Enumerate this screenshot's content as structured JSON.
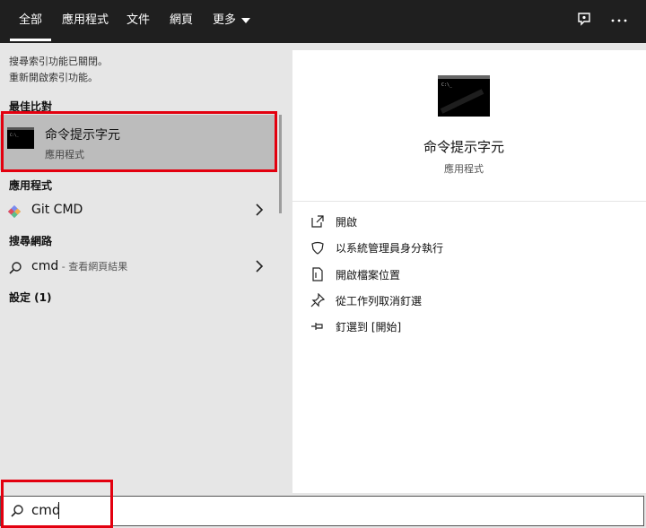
{
  "topbar": {
    "tabs": [
      {
        "label": "全部",
        "active": true
      },
      {
        "label": "應用程式"
      },
      {
        "label": "文件"
      },
      {
        "label": "網頁"
      },
      {
        "label": "更多"
      }
    ],
    "feedback_icon": "feedback-icon",
    "more_icon": "ellipsis-icon"
  },
  "left": {
    "notice_line1": "搜尋索引功能已關閉。",
    "notice_line2": "重新開啟索引功能。",
    "best_match_header": "最佳比對",
    "best_match": {
      "title": "命令提示字元",
      "subtitle": "應用程式",
      "icon": "terminal-icon"
    },
    "apps_header": "應用程式",
    "apps": [
      {
        "label": "Git CMD",
        "icon": "git-icon"
      }
    ],
    "web_header": "搜尋網路",
    "web_result": {
      "query": "cmd",
      "suffix": " - 查看網頁結果",
      "icon": "search-icon"
    },
    "settings_header": "設定 (1)"
  },
  "right": {
    "title": "命令提示字元",
    "subtitle": "應用程式",
    "actions": [
      {
        "label": "開啟",
        "icon": "open-icon"
      },
      {
        "label": "以系統管理員身分執行",
        "icon": "shield-icon"
      },
      {
        "label": "開啟檔案位置",
        "icon": "file-location-icon"
      },
      {
        "label": "從工作列取消釘選",
        "icon": "unpin-icon"
      },
      {
        "label": "釘選到 [開始]",
        "icon": "pin-icon"
      }
    ]
  },
  "search": {
    "value": "cmd",
    "icon": "search-icon"
  },
  "colors": {
    "highlight": "#e3000f",
    "topbar": "#1f1f1f",
    "selected_row": "#bcbcbc"
  }
}
